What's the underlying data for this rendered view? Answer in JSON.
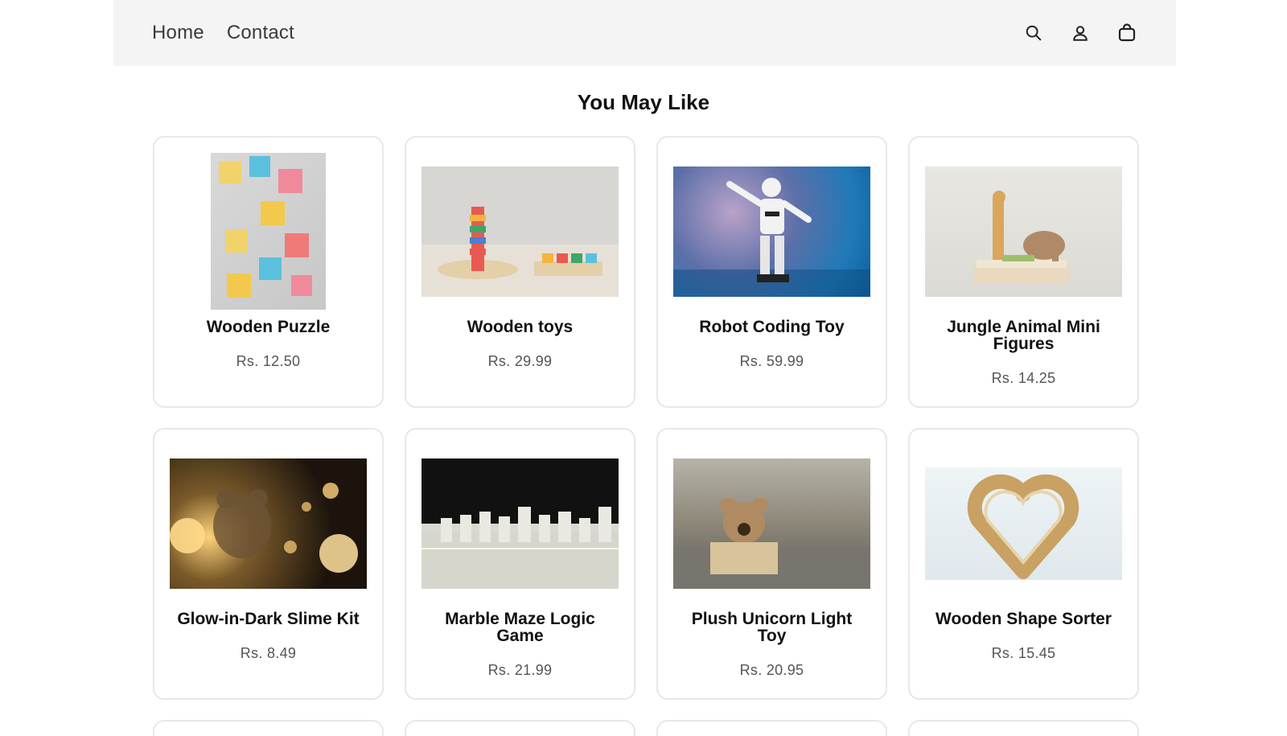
{
  "header": {
    "nav": [
      {
        "label": "Home"
      },
      {
        "label": "Contact"
      }
    ],
    "icons": [
      "search-icon",
      "user-icon",
      "bag-icon"
    ]
  },
  "section": {
    "title": "You May Like"
  },
  "products": [
    {
      "name": "Wooden Puzzle",
      "price": "Rs. 12.50",
      "image": "wooden-puzzle-image"
    },
    {
      "name": "Wooden toys",
      "price": "Rs. 29.99",
      "image": "wooden-toys-image"
    },
    {
      "name": "Robot Coding Toy",
      "price": "Rs. 59.99",
      "image": "robot-image"
    },
    {
      "name": "Jungle Animal Mini Figures",
      "price": "Rs. 14.25",
      "image": "jungle-figures-image"
    },
    {
      "name": "Glow-in-Dark Slime Kit",
      "price": "Rs. 8.49",
      "image": "slime-kit-image"
    },
    {
      "name": "Marble Maze Logic Game",
      "price": "Rs. 21.99",
      "image": "chess-board-image"
    },
    {
      "name": "Plush Unicorn Light Toy",
      "price": "Rs. 20.95",
      "image": "plush-toy-image"
    },
    {
      "name": "Wooden Shape Sorter",
      "price": "Rs. 15.45",
      "image": "wooden-heart-image"
    }
  ]
}
